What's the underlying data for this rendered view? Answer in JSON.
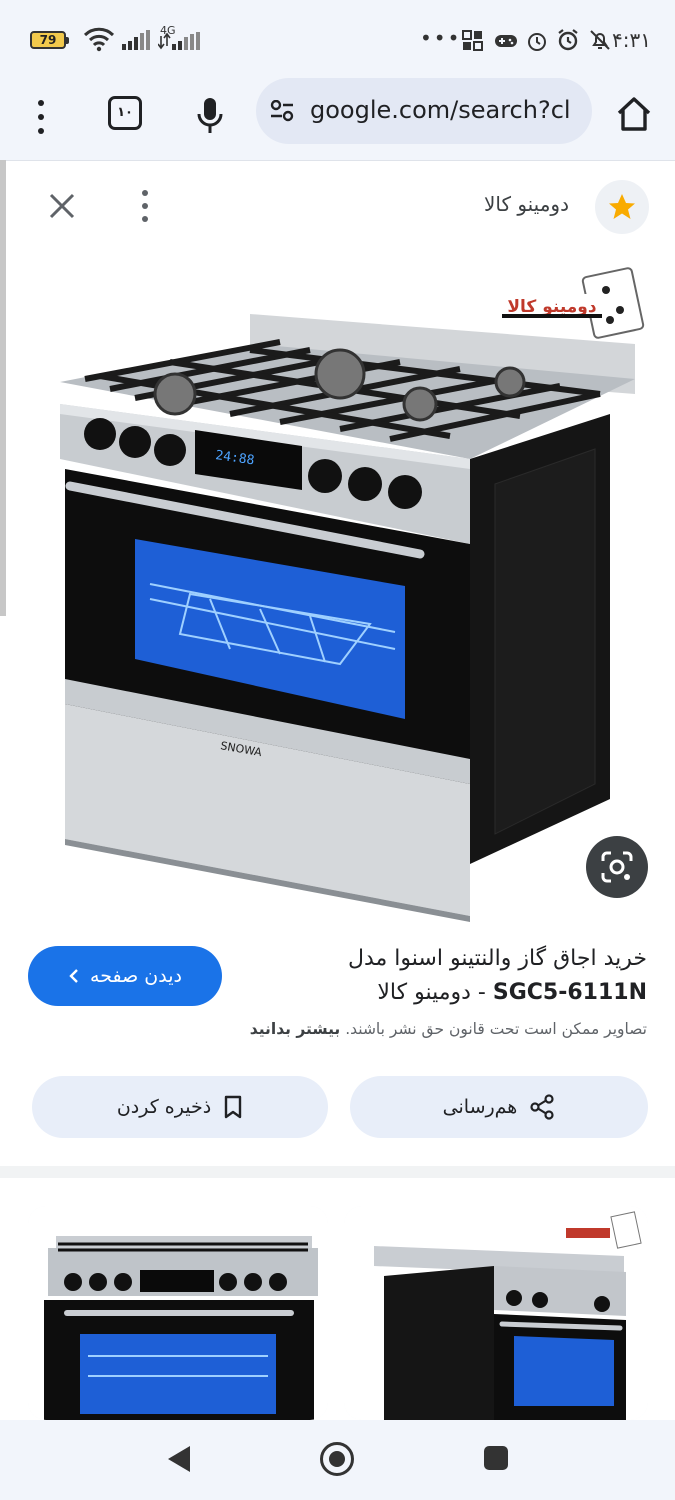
{
  "status_bar": {
    "battery": "79",
    "network": "4G",
    "overflow": "•••",
    "time": "۴:۳۱"
  },
  "browser": {
    "tab_count": "۱۰",
    "url": "google.com/search?cl"
  },
  "panel": {
    "source_name": "دومینو کالا"
  },
  "main_image": {
    "logo_text": "دومینو کالا",
    "brand_text": "SNOWA",
    "display_text": "24:88"
  },
  "result": {
    "visit_label": "دیدن صفحه",
    "title_line1": "خرید اجاق گاز والنتینو اسنوا مدل",
    "title_sku": "SGC5-6111N",
    "title_suffix": " - دومینو کالا",
    "copyright_text": "تصاویر ممکن است تحت قانون حق نشر باشند.",
    "learn_more": "بیشتر بدانید"
  },
  "actions": {
    "share_label": "هم‌رسانی",
    "save_label": "ذخیره کردن"
  },
  "colors": {
    "accent": "#1a73e8",
    "pill_bg": "#e8eef9",
    "oven_glass": "#1e5fd6"
  }
}
